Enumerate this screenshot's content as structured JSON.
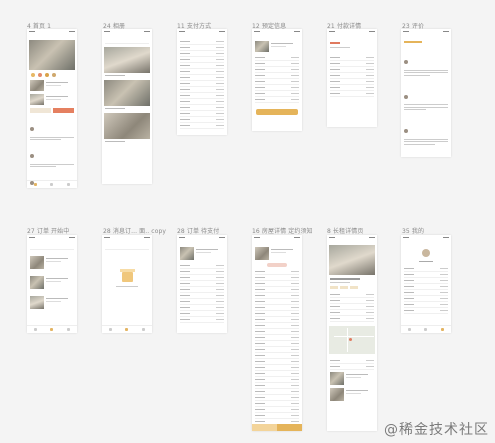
{
  "labels": [
    "4 首页 1",
    "24 相册",
    "11 支付方式",
    "12 预定信息",
    "21 付款详情",
    "23 评价",
    "27 订单 开始中",
    "28 消息订... 面.. copy",
    "28 订单 待支付",
    "16 房屋详情 定约须知",
    "8 长租详情页",
    "35 我的"
  ],
  "watermark": "@稀金技术社区",
  "accent_color": "#e5b45a",
  "icons": [
    "status-bar-icon",
    "tab-home-icon",
    "tab-order-icon",
    "tab-user-icon",
    "empty-box-icon",
    "map-pin-icon",
    "avatar-icon"
  ]
}
